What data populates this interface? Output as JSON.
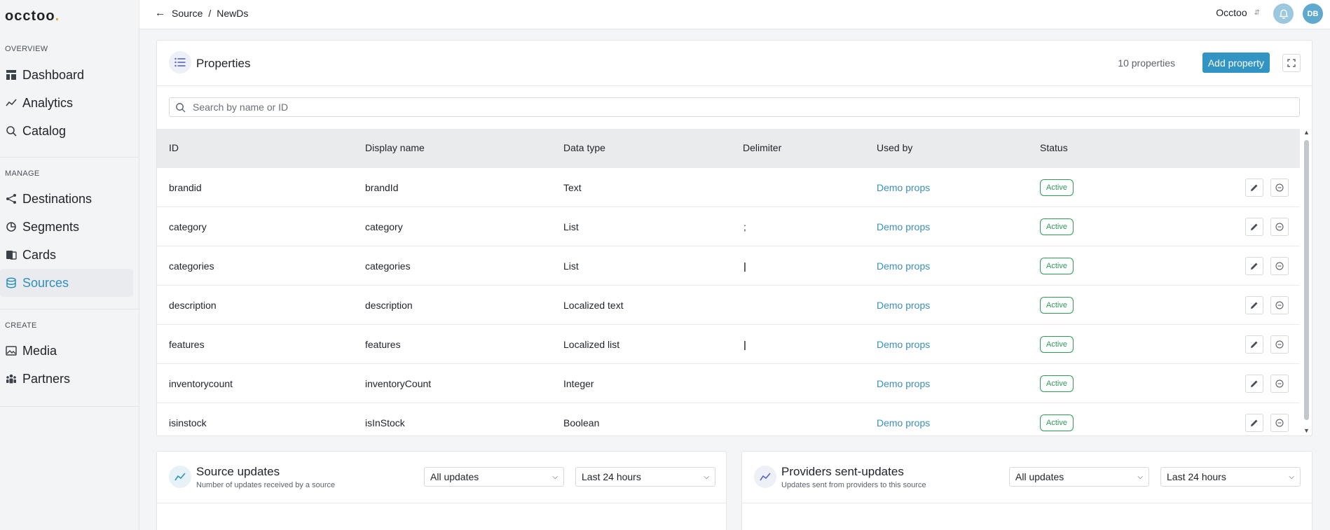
{
  "logo": {
    "text": "occtoo",
    "dot": "."
  },
  "sidebar": {
    "sections": [
      {
        "label": "OVERVIEW",
        "items": [
          {
            "label": "Dashboard",
            "icon": "dashboard-icon"
          },
          {
            "label": "Analytics",
            "icon": "analytics-icon"
          },
          {
            "label": "Catalog",
            "icon": "search-icon"
          }
        ]
      },
      {
        "label": "MANAGE",
        "items": [
          {
            "label": "Destinations",
            "icon": "share-icon"
          },
          {
            "label": "Segments",
            "icon": "pie-icon"
          },
          {
            "label": "Cards",
            "icon": "cards-icon"
          },
          {
            "label": "Sources",
            "icon": "database-icon",
            "active": true
          }
        ]
      },
      {
        "label": "CREATE",
        "items": [
          {
            "label": "Media",
            "icon": "image-icon"
          },
          {
            "label": "Partners",
            "icon": "people-icon"
          }
        ]
      }
    ]
  },
  "topbar": {
    "breadcrumb": [
      "Source",
      "NewDs"
    ],
    "separator": "/",
    "org": "Occtoo",
    "avatar": "DB"
  },
  "properties": {
    "title": "Properties",
    "count": "10 properties",
    "add_label": "Add property",
    "search_placeholder": "Search by name or ID",
    "columns": [
      "ID",
      "Display name",
      "Data type",
      "Delimiter",
      "Used by",
      "Status"
    ],
    "rows": [
      {
        "id": "brandid",
        "display": "brandId",
        "type": "Text",
        "delimiter": "",
        "used_by": "Demo props",
        "status": "Active"
      },
      {
        "id": "category",
        "display": "category",
        "type": "List",
        "delimiter": ";",
        "used_by": "Demo props",
        "status": "Active"
      },
      {
        "id": "categories",
        "display": "categories",
        "type": "List",
        "delimiter": "|",
        "used_by": "Demo props",
        "status": "Active"
      },
      {
        "id": "description",
        "display": "description",
        "type": "Localized text",
        "delimiter": "",
        "used_by": "Demo props",
        "status": "Active"
      },
      {
        "id": "features",
        "display": "features",
        "type": "Localized list",
        "delimiter": "|",
        "used_by": "Demo props",
        "status": "Active"
      },
      {
        "id": "inventorycount",
        "display": "inventoryCount",
        "type": "Integer",
        "delimiter": "",
        "used_by": "Demo props",
        "status": "Active"
      },
      {
        "id": "isinstock",
        "display": "isInStock",
        "type": "Boolean",
        "delimiter": "",
        "used_by": "Demo props",
        "status": "Active"
      }
    ]
  },
  "source_updates": {
    "title": "Source updates",
    "subtitle": "Number of updates received by a source",
    "filter_type": "All updates",
    "filter_range": "Last 24 hours"
  },
  "provider_updates": {
    "title": "Providers sent-updates",
    "subtitle": "Updates sent from providers to this source",
    "filter_type": "All updates",
    "filter_range": "Last 24 hours"
  },
  "colors": {
    "accent": "#3294c3",
    "active_status": "#2e9c58",
    "link": "#3a8fbd",
    "logo_dot": "#e7a43b"
  }
}
